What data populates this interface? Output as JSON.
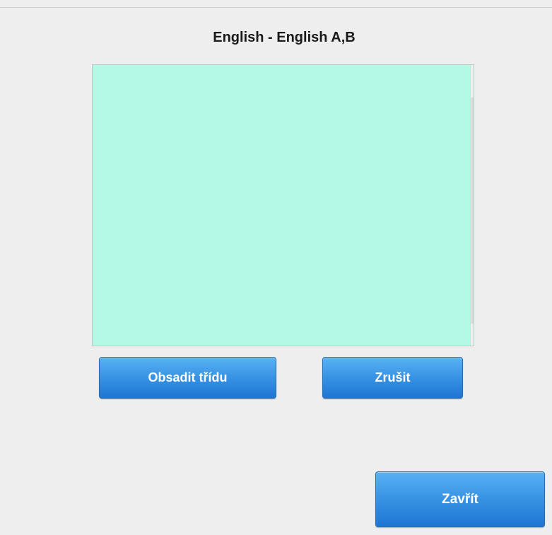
{
  "dialog": {
    "title": "English - English A,B"
  },
  "list": {
    "items": [],
    "background_color": "#b4f9e6"
  },
  "buttons": {
    "assign_label": "Obsadit třídu",
    "cancel_label": "Zrušit",
    "close_label": "Zavřít"
  },
  "colors": {
    "button_accent": "#3792e4",
    "background": "#eeeeee"
  }
}
